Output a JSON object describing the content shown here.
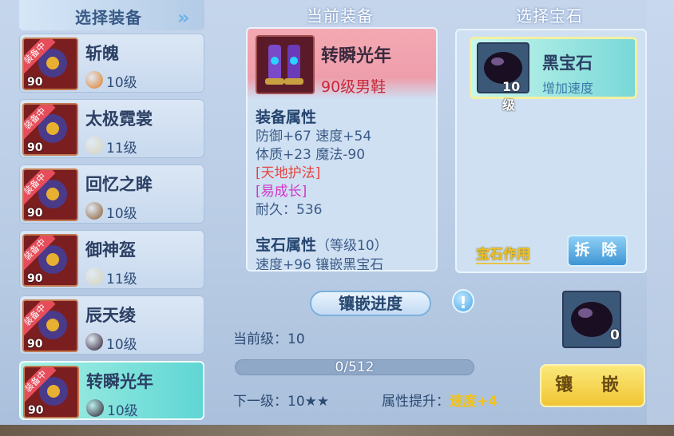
{
  "left_panel": {
    "title": "选择装备",
    "items": [
      {
        "name": "斩魄",
        "level": "90",
        "gem_level": "10级",
        "badge": "装备中",
        "gem_color": "#e07a1e"
      },
      {
        "name": "太极霓裳",
        "level": "90",
        "gem_level": "11级",
        "badge": "装备中",
        "gem_color": "#d8d4b8"
      },
      {
        "name": "回忆之眸",
        "level": "90",
        "gem_level": "10级",
        "badge": "装备中",
        "gem_color": "#8a5a2a"
      },
      {
        "name": "御神盔",
        "level": "90",
        "gem_level": "11级",
        "badge": "装备中",
        "gem_color": "#d8d4b8"
      },
      {
        "name": "辰天绫",
        "level": "90",
        "gem_level": "10级",
        "badge": "装备中",
        "gem_color": "#2a1a2e"
      },
      {
        "name": "转瞬光年",
        "level": "90",
        "gem_level": "10级",
        "badge": "装备中",
        "gem_color": "#2a1a2e"
      }
    ]
  },
  "current_equipment": {
    "title": "当前装备",
    "name": "转瞬光年",
    "subtitle": "90级男鞋",
    "attr_header": "装备属性",
    "attr_line1": "防御+67 速度+54",
    "attr_line2": "体质+23 魔法-90",
    "special1": "[天地护法]",
    "special2": "[易成长]",
    "durability": "耐久：536",
    "gem_attr_header": "宝石属性",
    "gem_attr_level": "（等级10）",
    "gem_attr_line": "速度+96 镶嵌黑宝石"
  },
  "gem_panel": {
    "title": "选择宝石",
    "gem_name": "黑宝石",
    "gem_level": "10级",
    "gem_desc": "增加速度",
    "effect_label": "宝石作用",
    "remove_label": "拆 除"
  },
  "progress": {
    "title": "镶嵌进度",
    "current_level": "当前级：10",
    "value": 0,
    "max": 512,
    "text": "0/512",
    "next_level": "下一级：10★★",
    "boost_label": "属性提升：",
    "boost_value": "速度+4",
    "gem_count": "0",
    "inlay_label": "镶 嵌"
  }
}
